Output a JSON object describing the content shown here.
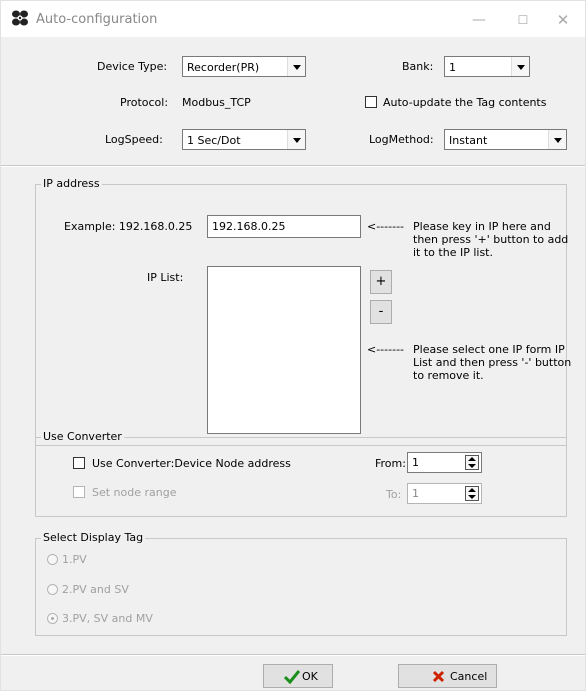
{
  "window": {
    "title": "Auto-configuration",
    "minimize": "—",
    "maximize": "☐",
    "close": "✕"
  },
  "device": {
    "type_label": "Device Type:",
    "type_value": "Recorder(PR)",
    "bank_label": "Bank:",
    "bank_value": "1",
    "protocol_label": "Protocol:",
    "protocol_value": "Modbus_TCP",
    "auto_update_label": "Auto-update the Tag contents",
    "logspeed_label": "LogSpeed:",
    "logspeed_value": "1 Sec/Dot",
    "logmethod_label": "LogMethod:",
    "logmethod_value": "Instant"
  },
  "ip": {
    "group_title": "IP address",
    "example_label": "Example: 192.168.0.25",
    "ip_value": "192.168.0.25",
    "arrow": "<-------",
    "add_note": "Please key in IP here and then press '+' button to add it to the IP list.",
    "list_label": "IP List:",
    "plus_label": "+",
    "minus_label": "-",
    "remove_note": "Please select one IP form IP List and then press '-' button to remove it."
  },
  "converter": {
    "group_title": "Use Converter",
    "use_label": "Use Converter:Device Node address",
    "range_label": "Set node range",
    "from_label": "From:",
    "from_value": "1",
    "to_label": "To:",
    "to_value": "1"
  },
  "display_tag": {
    "group_title": "Select Display Tag",
    "options": [
      "1.PV",
      "2.PV and SV",
      "3.PV, SV and MV"
    ]
  },
  "buttons": {
    "ok": "OK",
    "cancel": "Cancel"
  },
  "colors": {
    "ok_check": "#1a8f1a",
    "cancel_x": "#cc2200",
    "disabled_text": "#a0a0a0"
  }
}
